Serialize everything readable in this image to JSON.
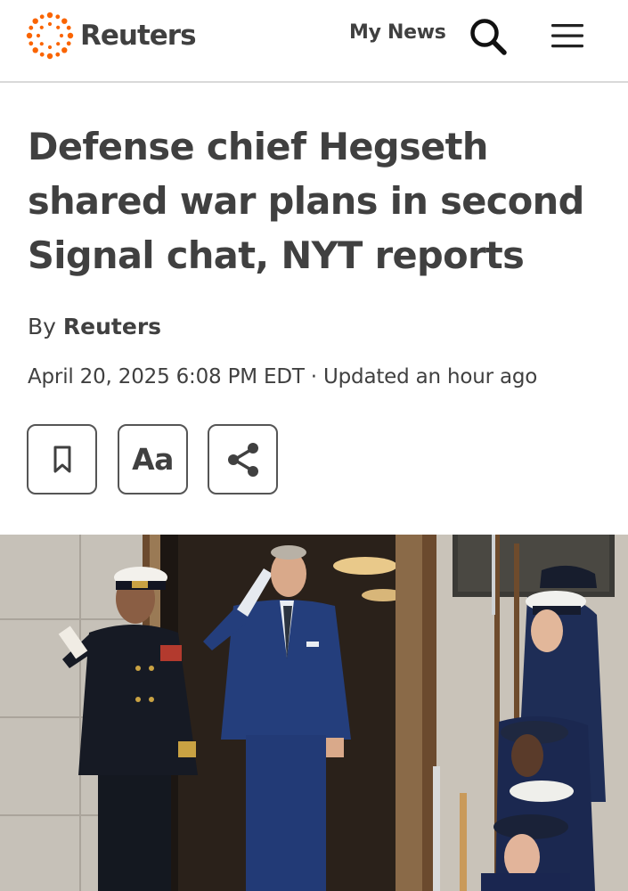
{
  "header": {
    "brand": "Reuters",
    "my_news_label": "My News",
    "search_icon": "search-icon",
    "menu_icon": "hamburger-menu-icon"
  },
  "article": {
    "headline": "Defense chief Hegseth shared war plans in second Signal chat, NYT reports",
    "byline_prefix": "By",
    "author": "Reuters",
    "dateline": "April 20, 2025 6:08 PM EDT · Updated an hour ago"
  },
  "toolbar": {
    "bookmark_icon": "bookmark-icon",
    "text_size_label": "Aa",
    "share_icon": "share-icon"
  },
  "colors": {
    "brand_orange": "#fa6400",
    "text": "#404040",
    "divider": "#d9d9d9"
  }
}
